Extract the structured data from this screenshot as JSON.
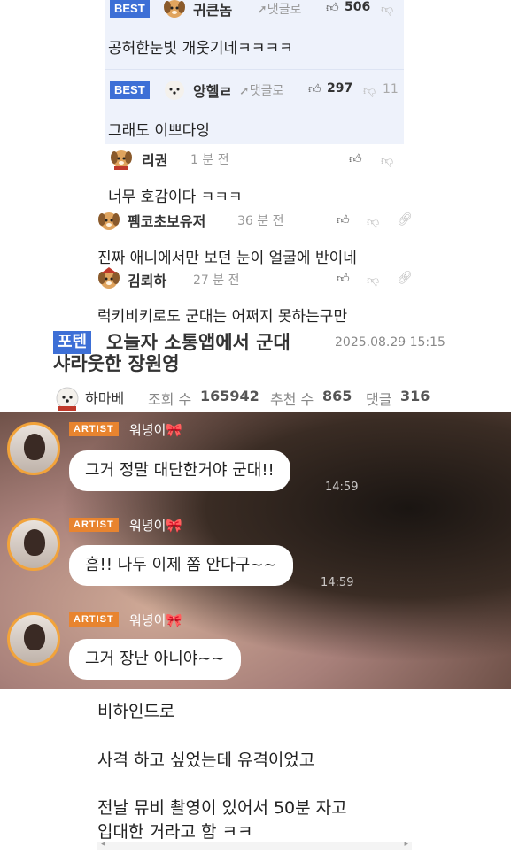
{
  "comments_top": [
    {
      "best": "BEST",
      "nick": "귀큰놈",
      "reply": "댓글로",
      "likes": "506",
      "text": "공허한눈빛 개웃기네ㅋㅋㅋㅋ"
    },
    {
      "best": "BEST",
      "nick": "앙헬ㄹ",
      "reply": "댓글로",
      "likes": "297",
      "dislikes": "11",
      "text": "그래도 이쁘다잉"
    }
  ],
  "comments": [
    {
      "nick": "리권",
      "time": "1 분 전",
      "text": "너무 호감이다 ㅋㅋㅋ"
    },
    {
      "nick": "펨코초보유저",
      "time": "36 분 전",
      "text": "진짜 애니에서만 보던 눈이 얼굴에 반이네"
    },
    {
      "nick": "김뢰하",
      "time": "27 분 전",
      "text": "럭키비키로도 군대는 어쩌지 못하는구만"
    }
  ],
  "post": {
    "tag": "포텐",
    "title_line1": "오늘자 소통앱에서 군대",
    "title_line2": "샤라웃한 장원영",
    "datetime": "2025.08.29 15:15",
    "author": "하마베",
    "views_label": "조회 수",
    "views": "165942",
    "recommend_label": "추천 수",
    "recommend": "865",
    "comments_label": "댓글",
    "comments": "316"
  },
  "chat": [
    {
      "badge": "ARTIST",
      "name": "워녕이🎀",
      "message": "그거 정말 대단한거야 군대!!",
      "time": "14:59"
    },
    {
      "badge": "ARTIST",
      "name": "워녕이🎀",
      "message": "흠!! 나두 이제 쫌 안다구~~",
      "time": "14:59"
    },
    {
      "badge": "ARTIST",
      "name": "워녕이🎀",
      "message": "그거 장난 아니야~~"
    }
  ],
  "body": {
    "line1": "비하인드로",
    "line2": "사격 하고 싶었는데 유격이었고",
    "line3": "전날 뮤비 촬영이 있어서 50분 자고",
    "line4": "입대한 거라고 함 ㅋㅋ"
  },
  "icons": {
    "avatar": "puppy-avatar-icon",
    "reply": "reply-arrow-icon",
    "like": "thumbs-up-icon",
    "dislike": "thumbs-down-icon",
    "share": "link-icon"
  },
  "colors": {
    "accent": "#3d6fd6",
    "artist": "#e8842f",
    "best_bg": "#eef2fb"
  }
}
